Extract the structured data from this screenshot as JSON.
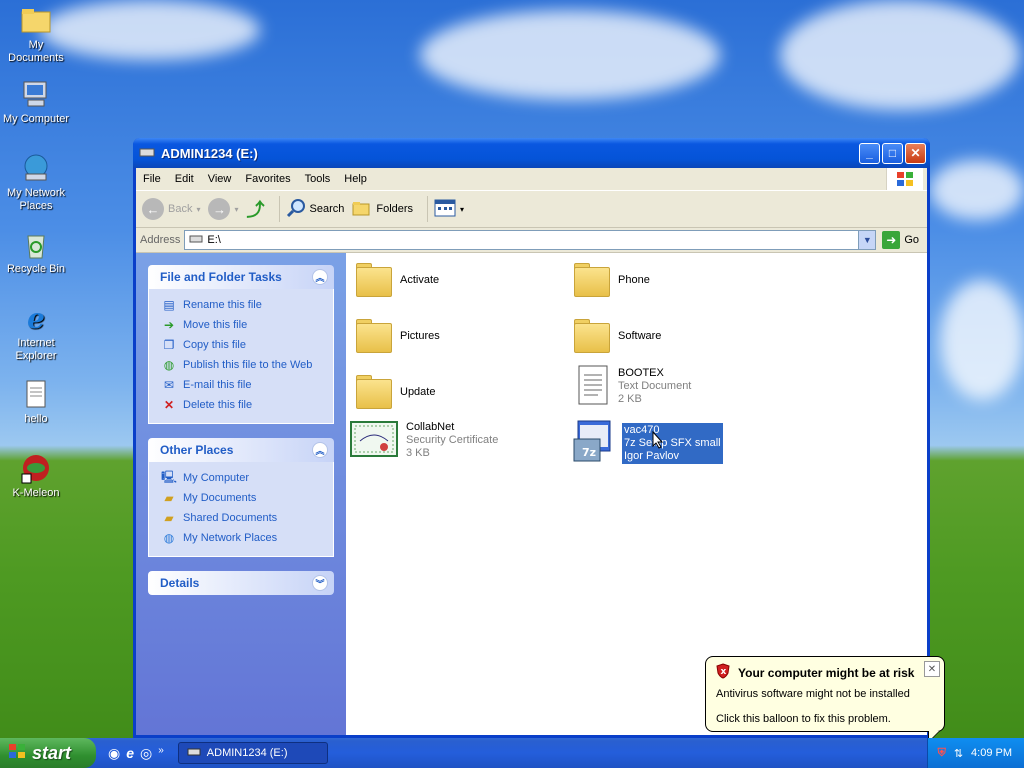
{
  "desktop": {
    "icons": [
      {
        "label": "My Documents"
      },
      {
        "label": "My Computer"
      },
      {
        "label": "My Network Places"
      },
      {
        "label": "Recycle Bin"
      },
      {
        "label": "Internet Explorer"
      },
      {
        "label": "hello"
      },
      {
        "label": "K-Meleon"
      }
    ]
  },
  "window": {
    "title": "ADMIN1234 (E:)",
    "menu": [
      "File",
      "Edit",
      "View",
      "Favorites",
      "Tools",
      "Help"
    ],
    "toolbar": {
      "back": "Back",
      "search": "Search",
      "folders": "Folders"
    },
    "address": {
      "label": "Address",
      "value": "E:\\",
      "go": "Go"
    }
  },
  "left_pane": {
    "file_tasks": {
      "title": "File and Folder Tasks",
      "items": [
        {
          "label": "Rename this file",
          "icon": "rename-icon"
        },
        {
          "label": "Move this file",
          "icon": "move-icon"
        },
        {
          "label": "Copy this file",
          "icon": "copy-icon"
        },
        {
          "label": "Publish this file to the Web",
          "icon": "publish-web-icon"
        },
        {
          "label": "E-mail this file",
          "icon": "email-icon"
        },
        {
          "label": "Delete this file",
          "icon": "delete-icon"
        }
      ]
    },
    "other_places": {
      "title": "Other Places",
      "items": [
        {
          "label": "My Computer",
          "icon": "computer-icon"
        },
        {
          "label": "My Documents",
          "icon": "documents-icon"
        },
        {
          "label": "Shared Documents",
          "icon": "shared-folder-icon"
        },
        {
          "label": "My Network Places",
          "icon": "network-icon"
        }
      ]
    },
    "details": {
      "title": "Details"
    }
  },
  "files": [
    {
      "name": "Activate",
      "type": "folder"
    },
    {
      "name": "Phone",
      "type": "folder"
    },
    {
      "name": "Pictures",
      "type": "folder"
    },
    {
      "name": "Software",
      "type": "folder"
    },
    {
      "name": "Update",
      "type": "folder"
    },
    {
      "name": "BOOTEX",
      "line2": "Text Document",
      "line3": "2 KB",
      "type": "text"
    },
    {
      "name": "CollabNet",
      "line2": "Security Certificate",
      "line3": "3 KB",
      "type": "certificate"
    },
    {
      "name": "vac470",
      "line2": "7z Setup SFX small",
      "line3": "Igor Pavlov",
      "type": "7z",
      "selected": true
    }
  ],
  "taskbar": {
    "start": "start",
    "task_button": "ADMIN1234 (E:)",
    "clock": "4:09 PM"
  },
  "balloon": {
    "title": "Your computer might be at risk",
    "line1": "Antivirus software might not be installed",
    "line2": "Click this balloon to fix this problem."
  }
}
